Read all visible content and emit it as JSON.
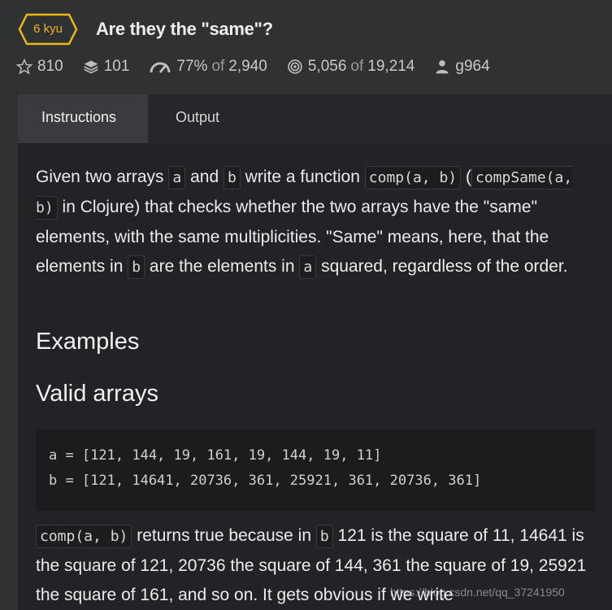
{
  "kata": {
    "rank": "6 kyu",
    "title": "Are they the \"same\"?"
  },
  "stats": {
    "stars": "810",
    "collections": "101",
    "satisfaction": "77%",
    "of1": "of",
    "votes": "2,940",
    "completed": "5,056",
    "of2": "of",
    "attempted": "19,214",
    "author": "g964"
  },
  "tabs": [
    "Instructions",
    "Output"
  ],
  "description": {
    "p1_a": "Given two arrays",
    "code_a": "a",
    "p1_and": "and",
    "code_b": "b",
    "p1_write": "write a function",
    "code_comp": "comp(a, b)",
    "p1_paren_open": "(",
    "code_compsame": "compSame(a, b)",
    "p1_rest": "in Clojure) that checks whether the two arrays have the \"same\" elements, with the same multiplicities. \"Same\" means, here, that the elements in",
    "code_b2": "b",
    "p1_are": "are the elements in",
    "code_a2": "a",
    "p1_end": "squared, regardless of the order."
  },
  "headings": {
    "examples": "Examples",
    "valid": "Valid arrays"
  },
  "code_example": {
    "line1": "a = [121, 144, 19, 161, 19, 144, 19, 11]",
    "line2": "b = [121, 14641, 20736, 361, 25921, 361, 20736, 361]"
  },
  "explanation": {
    "code_comp": "comp(a, b)",
    "t1": "returns true because in",
    "code_b": "b",
    "t2": "121 is the square of 11, 14641 is the square of 121, 20736 the square of 144, 361 the square of 19, 25921 the square of 161, and so on. It gets obvious if we write"
  },
  "watermark": "https://blog.csdn.net/qq_37241950",
  "colors": {
    "rank": "#ecb613",
    "background": "#303133",
    "panel": "#222326"
  }
}
